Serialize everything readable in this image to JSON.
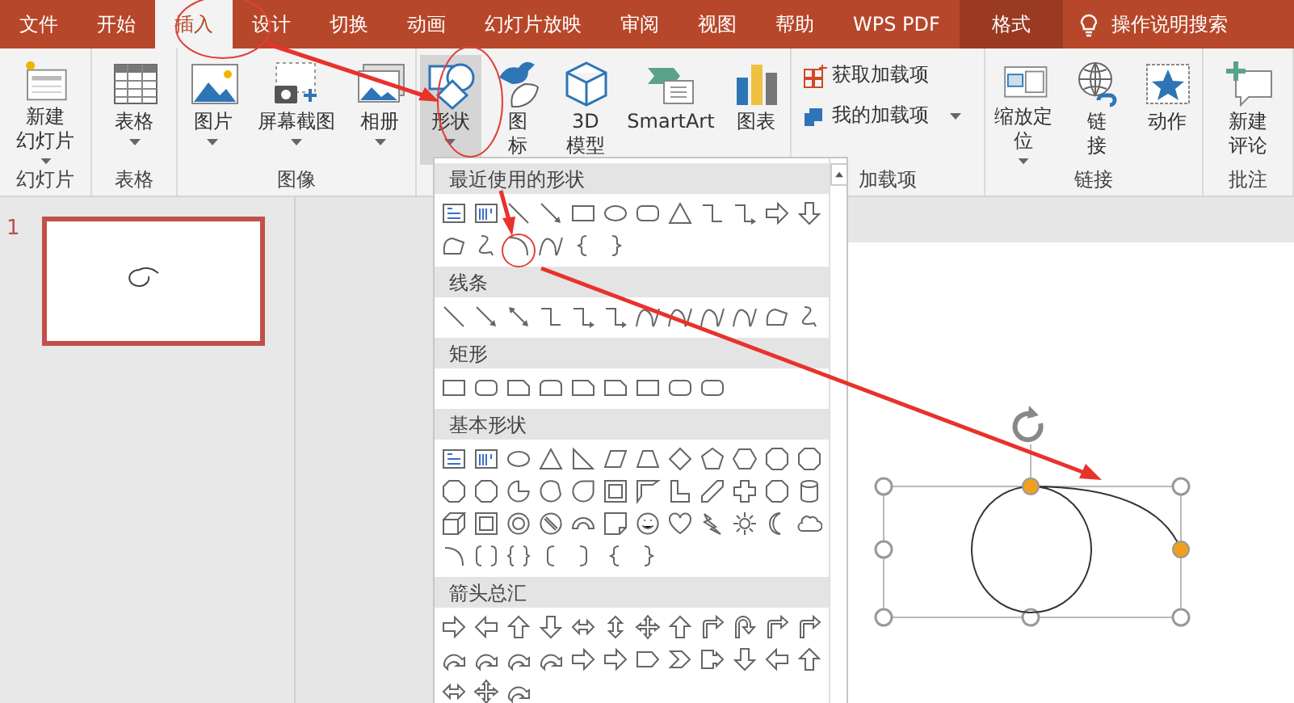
{
  "tabs": [
    {
      "label": "文件",
      "selected": false,
      "contextual": false
    },
    {
      "label": "开始",
      "selected": false,
      "contextual": false
    },
    {
      "label": "插入",
      "selected": true,
      "contextual": false
    },
    {
      "label": "设计",
      "selected": false,
      "contextual": false
    },
    {
      "label": "切换",
      "selected": false,
      "contextual": false
    },
    {
      "label": "动画",
      "selected": false,
      "contextual": false
    },
    {
      "label": "幻灯片放映",
      "selected": false,
      "contextual": false
    },
    {
      "label": "审阅",
      "selected": false,
      "contextual": false
    },
    {
      "label": "视图",
      "selected": false,
      "contextual": false
    },
    {
      "label": "帮助",
      "selected": false,
      "contextual": false
    },
    {
      "label": "WPS PDF",
      "selected": false,
      "contextual": false
    },
    {
      "label": "格式",
      "selected": false,
      "contextual": true
    }
  ],
  "tell_me": {
    "label": "操作说明搜索"
  },
  "ribbon": {
    "groups": [
      {
        "label": "幻灯片",
        "buttons": [
          {
            "kind": "large",
            "lines": [
              "新建",
              "幻灯片"
            ],
            "dropdown": true,
            "selected": false
          }
        ]
      },
      {
        "label": "表格",
        "buttons": [
          {
            "kind": "large",
            "lines": [
              "表格"
            ],
            "dropdown": true,
            "selected": false
          }
        ]
      },
      {
        "label": "图像",
        "buttons": [
          {
            "kind": "large",
            "lines": [
              "图片"
            ],
            "dropdown": true,
            "selected": false
          },
          {
            "kind": "large",
            "lines": [
              "屏幕截图"
            ],
            "dropdown": true,
            "selected": false
          },
          {
            "kind": "large",
            "lines": [
              "相册"
            ],
            "dropdown": true,
            "selected": false
          }
        ]
      },
      {
        "buttons": [
          {
            "kind": "large",
            "lines": [
              "形状"
            ],
            "dropdown": true,
            "selected": true
          },
          {
            "kind": "large",
            "lines": [
              "图",
              "标"
            ],
            "dropdown": false,
            "selected": false
          },
          {
            "kind": "large",
            "lines": [
              "3D",
              "模型"
            ],
            "dropdown": false,
            "selected": false
          },
          {
            "kind": "large",
            "lines": [
              "SmartArt"
            ],
            "dropdown": false,
            "selected": false
          },
          {
            "kind": "large",
            "lines": [
              "图表"
            ],
            "dropdown": false,
            "selected": false
          }
        ]
      },
      {
        "label": "加载项",
        "buttons": [
          {
            "kind": "small",
            "lines": [
              "获取加载项"
            ],
            "dropdown": false,
            "selected": false
          },
          {
            "kind": "small",
            "lines": [
              "我的加载项"
            ],
            "dropdown": true,
            "selected": false
          }
        ]
      },
      {
        "label": "链接",
        "buttons": [
          {
            "kind": "large",
            "lines": [
              "缩放定",
              "位"
            ],
            "dropdown": true,
            "selected": false
          },
          {
            "kind": "large",
            "lines": [
              "链",
              "接"
            ],
            "dropdown": false,
            "selected": false
          },
          {
            "kind": "large",
            "lines": [
              "动作"
            ],
            "dropdown": false,
            "selected": false
          }
        ]
      },
      {
        "label": "批注",
        "buttons": [
          {
            "kind": "large",
            "lines": [
              "新建",
              "评论"
            ],
            "dropdown": false,
            "selected": false
          }
        ]
      }
    ]
  },
  "slides": [
    {
      "number": "1",
      "selected": true
    }
  ],
  "shapes_menu": {
    "sections": [
      {
        "title": "最近使用的形状"
      },
      {
        "title": "线条"
      },
      {
        "title": "矩形"
      },
      {
        "title": "基本形状"
      },
      {
        "title": "箭头总汇"
      }
    ]
  },
  "canvas": {
    "shape": {
      "selected": true
    }
  }
}
